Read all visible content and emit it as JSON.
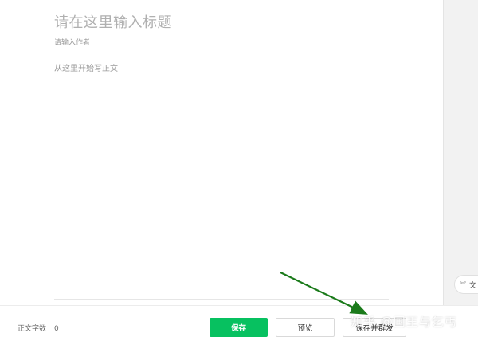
{
  "editor": {
    "title_placeholder": "请在这里输入标题",
    "author_placeholder": "请输入作者",
    "body_placeholder": "从这里开始写正文"
  },
  "footer": {
    "word_count_label": "正文字数",
    "word_count_value": "0",
    "save_label": "保存",
    "preview_label": "预览",
    "publish_label": "保存并群发"
  },
  "side_panel": {
    "toggle_label": "文"
  },
  "watermark": {
    "text": "知乎 @国王与乞丐"
  },
  "annotation": {
    "arrow_color": "#1a7a1a"
  },
  "colors": {
    "accent": "#07c160"
  }
}
